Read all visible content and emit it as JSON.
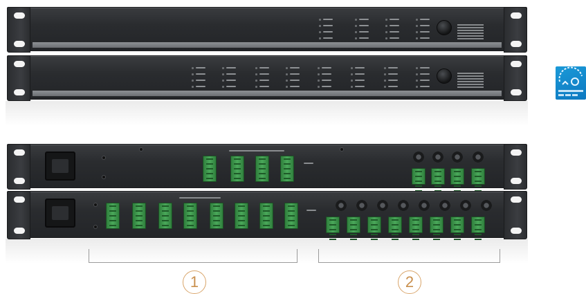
{
  "callouts": [
    {
      "number": "1"
    },
    {
      "number": "2"
    }
  ],
  "colors": {
    "chassis": "#2a2c2f",
    "terminal_green": "#4aa85a",
    "callout_accent": "#c98f4d",
    "badge_blue": "#1b9ad8"
  },
  "icons": {
    "badge": "eco-badge-icon"
  }
}
